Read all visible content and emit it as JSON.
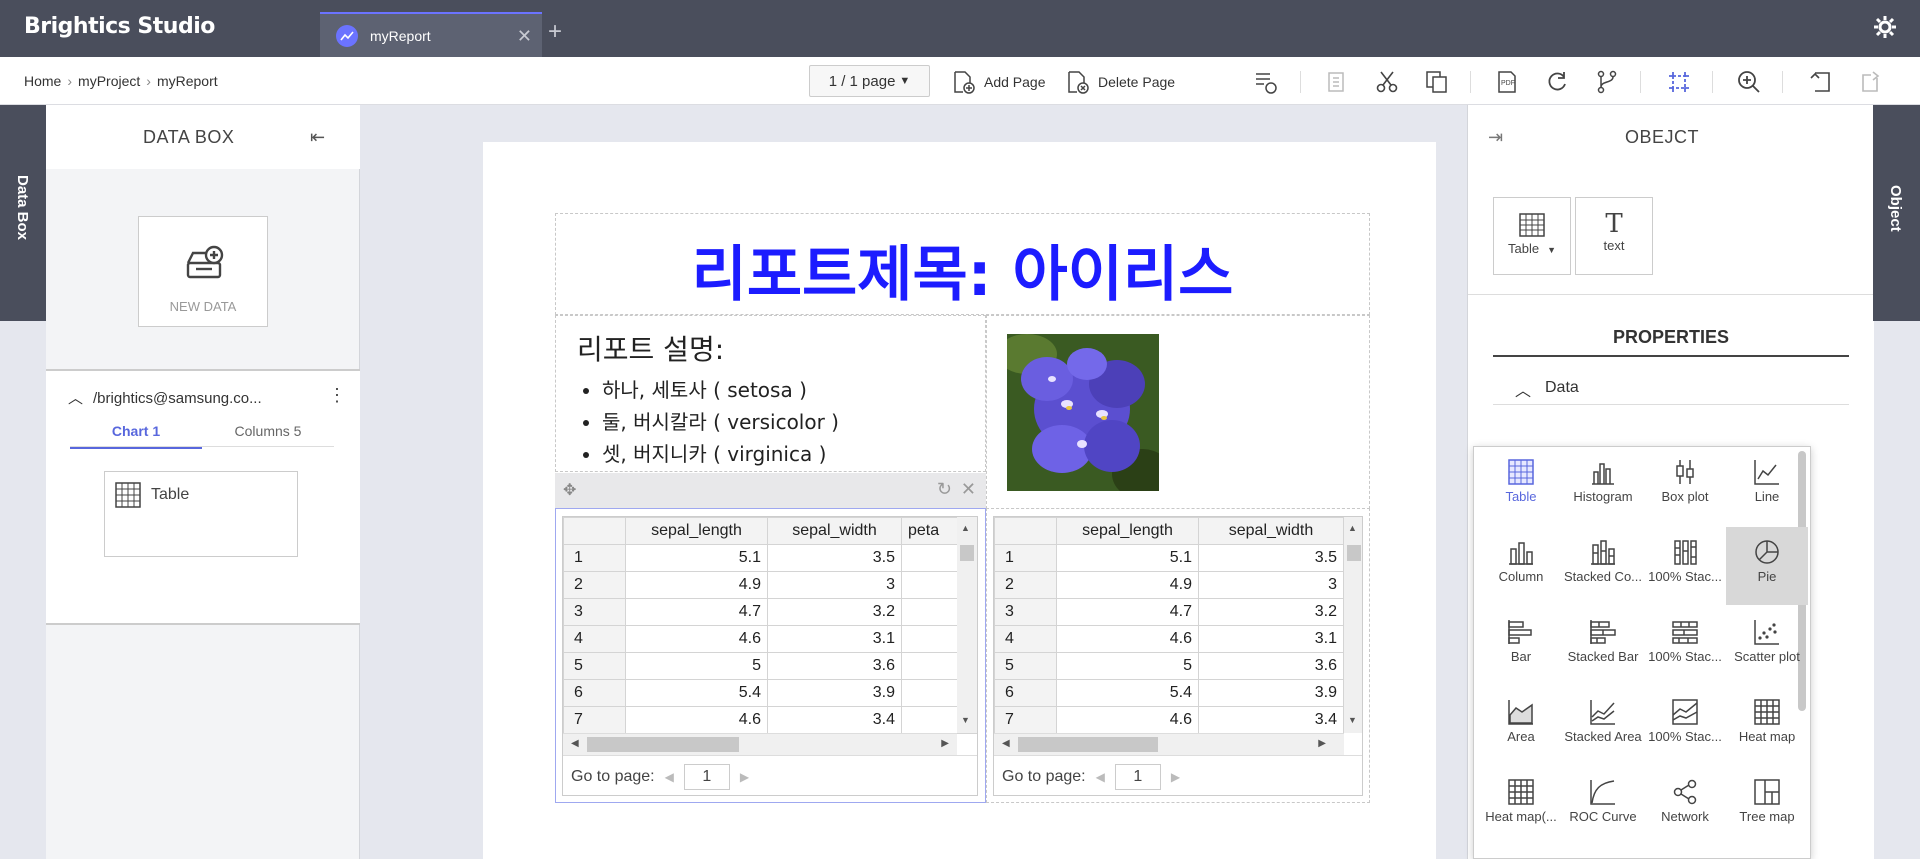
{
  "app": {
    "title": "Brightics Studio",
    "tab_label": "myReport"
  },
  "breadcrumb": [
    "Home",
    "myProject",
    "myReport"
  ],
  "toolbar": {
    "page_selector": "1 / 1 page",
    "add_page": "Add Page",
    "delete_page": "Delete Page"
  },
  "sidebar_tabs": {
    "left": "Data Box",
    "right": "Object"
  },
  "databox": {
    "title": "DATA BOX",
    "new_data_label": "NEW DATA",
    "path": "/brightics@samsung.co...",
    "tabs": [
      "Chart 1",
      "Columns 5"
    ],
    "card_label": "Table"
  },
  "report": {
    "title": "리포트제목: 아이리스",
    "desc_heading": "리포트 설명:",
    "desc_items": [
      "하나, 세토사 ( setosa )",
      "둘, 버시칼라 ( versicolor )",
      "셋, 버지니카 ( virginica )"
    ],
    "grid_headers_left": [
      "",
      "sepal_length",
      "sepal_width",
      "peta"
    ],
    "grid_headers_right": [
      "",
      "sepal_length",
      "sepal_width"
    ],
    "grid_rows": [
      [
        "1",
        "5.1",
        "3.5"
      ],
      [
        "2",
        "4.9",
        "3"
      ],
      [
        "3",
        "4.7",
        "3.2"
      ],
      [
        "4",
        "4.6",
        "3.1"
      ],
      [
        "5",
        "5",
        "3.6"
      ],
      [
        "6",
        "5.4",
        "3.9"
      ],
      [
        "7",
        "4.6",
        "3.4"
      ]
    ],
    "goto_label": "Go to page:",
    "goto_value": "1"
  },
  "object_panel": {
    "title": "OBEJCT",
    "items": [
      "Table",
      "text"
    ],
    "properties_title": "PROPERTIES",
    "data_section": "Data"
  },
  "chart_picker": {
    "items": [
      "Table",
      "Histogram",
      "Box plot",
      "Line",
      "Column",
      "Stacked Co...",
      "100% Stac...",
      "Pie",
      "Bar",
      "Stacked Bar",
      "100% Stac...",
      "Scatter plot",
      "Area",
      "Stacked Area",
      "100% Stac...",
      "Heat map",
      "Heat map(...",
      "ROC Curve",
      "Network",
      "Tree map"
    ],
    "selected": "Table",
    "hovered": "Pie"
  },
  "colors": {
    "accent": "#5867dd",
    "topbar": "#4a4e5c",
    "title_blue": "#1c1cff"
  }
}
